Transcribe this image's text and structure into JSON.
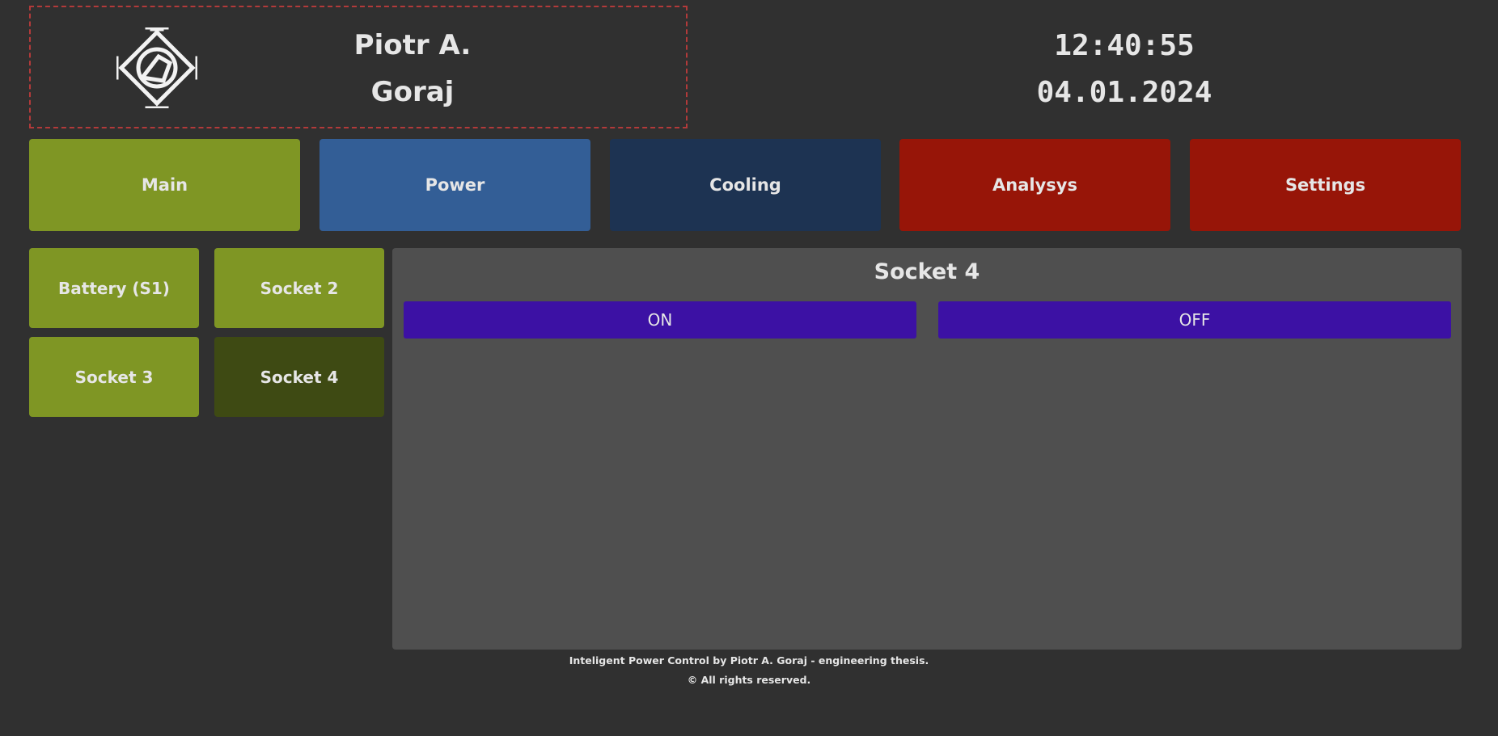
{
  "header": {
    "logo_icon": "diamond-logo-icon",
    "name_line1": "Piotr A.",
    "name_line2": "Goraj",
    "border_color": "#b23a3a"
  },
  "clock": {
    "time": "12:40:55",
    "date": "04.01.2024"
  },
  "nav": {
    "main": "Main",
    "power": "Power",
    "cooling": "Cooling",
    "analysys": "Analysys",
    "settings": "Settings"
  },
  "sockets": {
    "battery": "Battery (S1)",
    "socket2": "Socket 2",
    "socket3": "Socket 3",
    "socket4": "Socket 4",
    "selected": "Socket 4"
  },
  "panel": {
    "title": "Socket 4",
    "on_label": "ON",
    "off_label": "OFF"
  },
  "footer": {
    "line1": "Inteligent Power Control by Piotr A. Goraj - engineering thesis.",
    "line2": "© All rights reserved."
  },
  "colors": {
    "background": "#303030",
    "green": "#7f9624",
    "green_selected": "#3e4a13",
    "blue": "#335e96",
    "navy": "#1d3352",
    "red": "#971508",
    "purple": "#3c11a4",
    "panel": "#4f4f4f"
  }
}
